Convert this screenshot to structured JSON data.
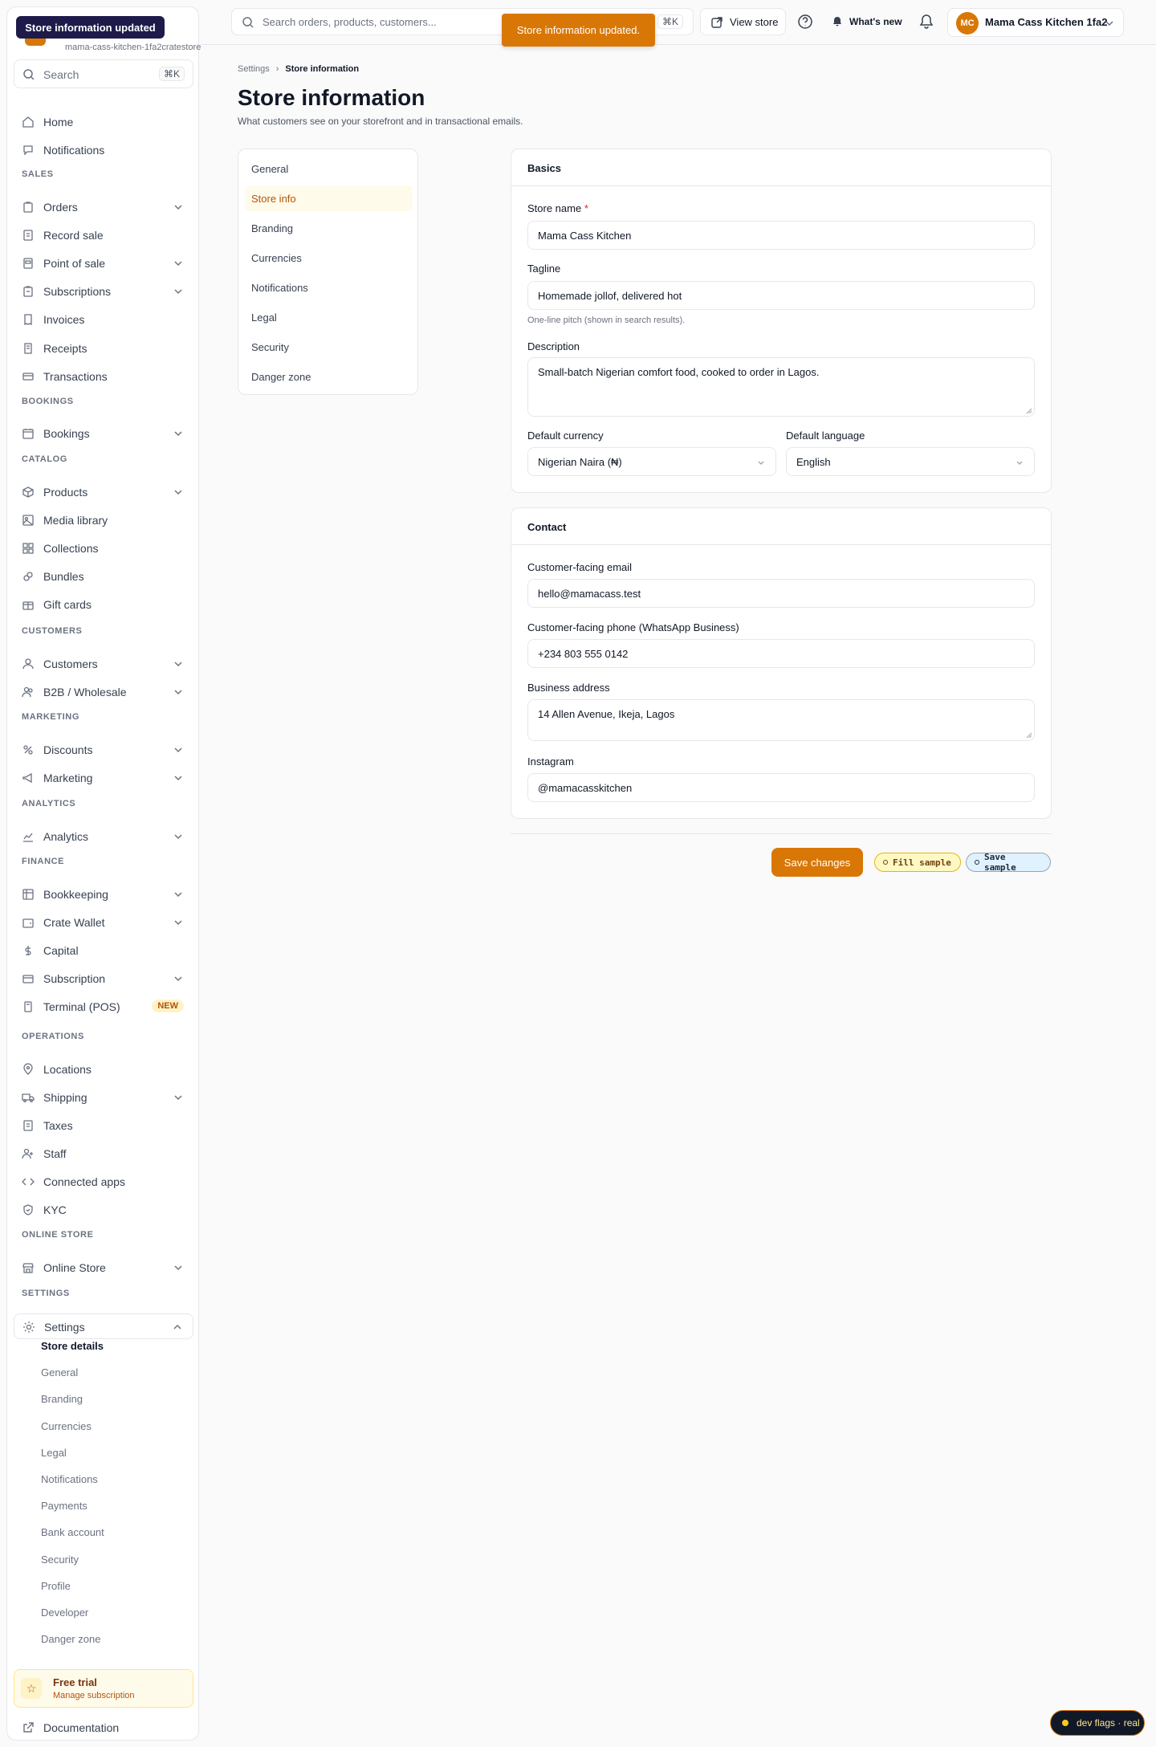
{
  "toast": "Store information updated.",
  "tooltip": "Store information updated",
  "sidebar": {
    "store_sub": "mama-cass-kitchen-1fa2cratestore",
    "search": {
      "label": "Search",
      "shortcut": "⌘K"
    },
    "items": [
      {
        "label": "Home"
      },
      {
        "label": "Notifications"
      },
      {
        "section": "SALES"
      },
      {
        "label": "Orders"
      },
      {
        "label": "Record sale"
      },
      {
        "label": "Point of sale"
      },
      {
        "label": "Subscriptions"
      },
      {
        "label": "Invoices"
      },
      {
        "label": "Receipts"
      },
      {
        "label": "Transactions"
      },
      {
        "section": "BOOKINGS"
      },
      {
        "label": "Bookings"
      },
      {
        "section": "CATALOG"
      },
      {
        "label": "Products"
      },
      {
        "label": "Media library"
      },
      {
        "label": "Collections"
      },
      {
        "label": "Bundles"
      },
      {
        "label": "Gift cards"
      },
      {
        "section": "CUSTOMERS"
      },
      {
        "label": "Customers"
      },
      {
        "label": "B2B / Wholesale"
      },
      {
        "section": "MARKETING"
      },
      {
        "label": "Discounts"
      },
      {
        "label": "Marketing"
      },
      {
        "section": "ANALYTICS"
      },
      {
        "label": "Analytics"
      },
      {
        "section": "FINANCE"
      },
      {
        "label": "Bookkeeping"
      },
      {
        "label": "Crate Wallet"
      },
      {
        "label": "Capital"
      },
      {
        "label": "Subscription"
      },
      {
        "label": "Terminal (POS)",
        "badge": "NEW"
      },
      {
        "section": "OPERATIONS"
      },
      {
        "label": "Locations"
      },
      {
        "label": "Shipping"
      },
      {
        "label": "Taxes"
      },
      {
        "label": "Staff"
      },
      {
        "label": "Connected apps"
      },
      {
        "label": "KYC"
      },
      {
        "section": "ONLINE STORE"
      },
      {
        "label": "Online Store"
      },
      {
        "section": "SETTINGS"
      },
      {
        "label": "Settings"
      }
    ],
    "settings_sub": [
      "Store details",
      "General",
      "Branding",
      "Currencies",
      "Legal",
      "Notifications",
      "Payments",
      "Bank account",
      "Security",
      "Profile",
      "Developer",
      "Danger zone"
    ],
    "trial": {
      "title": "Free trial",
      "sub": "Manage subscription"
    },
    "docs": "Documentation"
  },
  "topbar": {
    "search_placeholder": "Search orders, products, customers...",
    "search_shortcut": "⌘K",
    "view_store": "View store",
    "whats_new": "What's new",
    "user_initials": "MC",
    "user_name": "Mama Cass Kitchen 1fa2"
  },
  "page": {
    "breadcrumb": [
      "Settings",
      "Store information"
    ],
    "title": "Store information",
    "description": "What customers see on your storefront and in transactional emails.",
    "subnav": [
      "General",
      "Store info",
      "Branding",
      "Currencies",
      "Notifications",
      "Legal",
      "Security",
      "Danger zone"
    ],
    "basics": {
      "title": "Basics",
      "store_name_label": "Store name",
      "store_name": "Mama Cass Kitchen",
      "tagline_label": "Tagline",
      "tagline": "Homemade jollof, delivered hot",
      "tagline_hint": "One-line pitch (shown in search results).",
      "description_label": "Description",
      "description": "Small-batch Nigerian comfort food, cooked to order in Lagos.",
      "currency_label": "Default currency",
      "currency": "Nigerian Naira (₦)",
      "language_label": "Default language",
      "language": "English"
    },
    "contact": {
      "title": "Contact",
      "email_label": "Customer-facing email",
      "email": "hello@mamacass.test",
      "phone_label": "Customer-facing phone (WhatsApp Business)",
      "phone": "+234 803 555 0142",
      "address_label": "Business address",
      "address": "14 Allen Avenue, Ikeja, Lagos",
      "instagram_label": "Instagram",
      "instagram": "@mamacasskitchen"
    },
    "save_label": "Save changes",
    "fill_sample": "Fill sample",
    "save_sample": "Save sample"
  },
  "devflags": "dev flags · real",
  "colors": {
    "accent": "#d97706",
    "tooltip_bg": "#1e1b4b"
  }
}
